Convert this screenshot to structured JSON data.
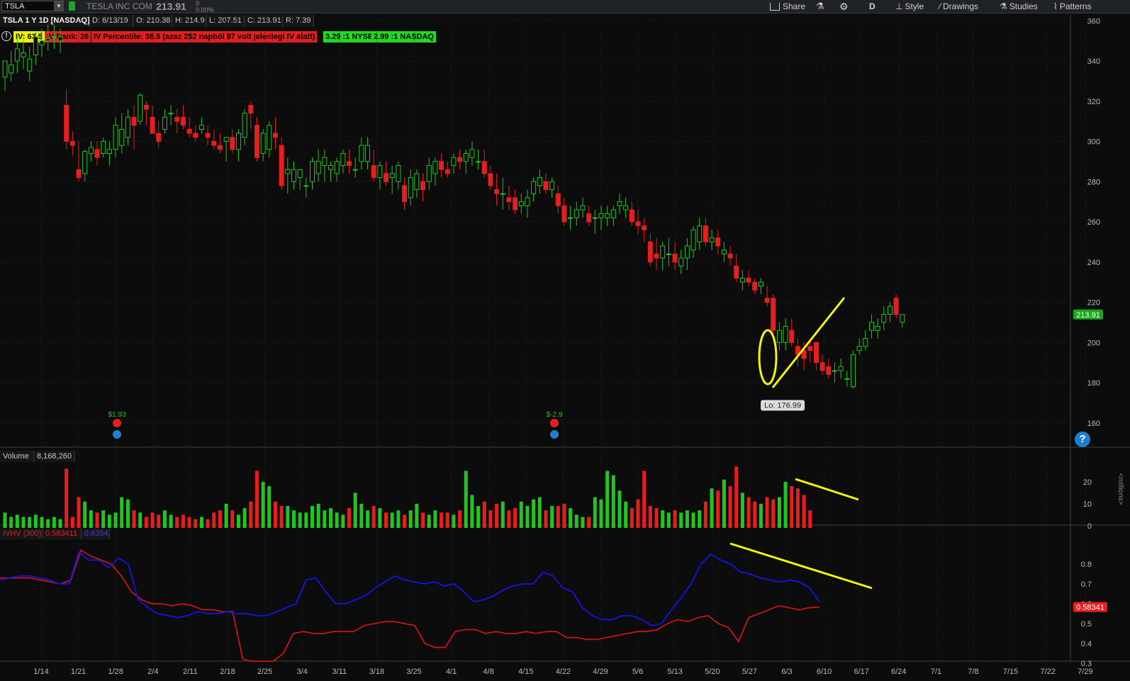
{
  "toolbar": {
    "symbol": "TSLA",
    "company": "TESLA INC COM",
    "last": "213.91",
    "change_top": "0",
    "change_pct": "0.00%",
    "buttons": [
      {
        "name": "share",
        "label": "Share"
      },
      {
        "name": "flask",
        "label": ""
      },
      {
        "name": "gear",
        "label": ""
      },
      {
        "name": "timeframe",
        "label": "D"
      },
      {
        "name": "style",
        "label": "Style"
      },
      {
        "name": "drawings",
        "label": "Drawings"
      },
      {
        "name": "studies",
        "label": "Studies"
      },
      {
        "name": "patterns",
        "label": "Patterns"
      }
    ]
  },
  "info": {
    "title": "TSLA 1 Y 1D [NASDAQ]",
    "date": "D: 6/13/19",
    "open": "O: 210.38",
    "high": "H: 214.9",
    "low": "L: 207.51",
    "close": "C: 213.91",
    "range": "R: 7.39"
  },
  "badges": {
    "iv": "IV: 63.5",
    "iv_rank": "IV Rank: 26",
    "iv_percentile": "IV Percentile: 38.5 (azaz 252 napból 97 volt jelenlegi IV alatt)",
    "nyse": "3.29 :1 NYSE",
    "nasdaq": "2.99 :1 NASDAQ"
  },
  "colors": {
    "up": "#22c422",
    "down": "#e61e1e",
    "iv_line": "#1414e6",
    "hv_line": "#cc1414",
    "annotation": "#f5f500",
    "price_tag": "#18a818"
  },
  "price_pane": {
    "axis_ticks": [
      "360",
      "340",
      "320",
      "300",
      "280",
      "260",
      "240",
      "220",
      "200",
      "180",
      "160"
    ],
    "last_price": "213.91",
    "low_label": "Lo: 176.99",
    "earnings": [
      {
        "value": "$1.93",
        "color": "#22c422"
      },
      {
        "value": "$-2.9",
        "color": "#22c422"
      }
    ]
  },
  "volume_pane": {
    "label": "Volume",
    "value": "8,168,260",
    "axis_ticks": [
      "20",
      "10",
      "0"
    ],
    "unit": "<millions>"
  },
  "ivhv_pane": {
    "label": "IVHV (300)",
    "hv_value": "0.583411",
    "iv_value": "0.6354",
    "axis_ticks": [
      "0.8",
      "0.7",
      "0.6",
      "0.5",
      "0.4",
      "0.3"
    ],
    "last_tag": "0.58341"
  },
  "x_axis": [
    "1/14",
    "1/21",
    "1/28",
    "2/4",
    "2/11",
    "2/18",
    "2/25",
    "3/4",
    "3/11",
    "3/18",
    "3/25",
    "4/1",
    "4/8",
    "4/15",
    "4/22",
    "4/29",
    "5/6",
    "5/13",
    "5/20",
    "5/27",
    "6/3",
    "6/10",
    "6/17",
    "6/24",
    "7/1",
    "7/8",
    "7/15",
    "7/22",
    "7/29"
  ],
  "help": "?"
}
